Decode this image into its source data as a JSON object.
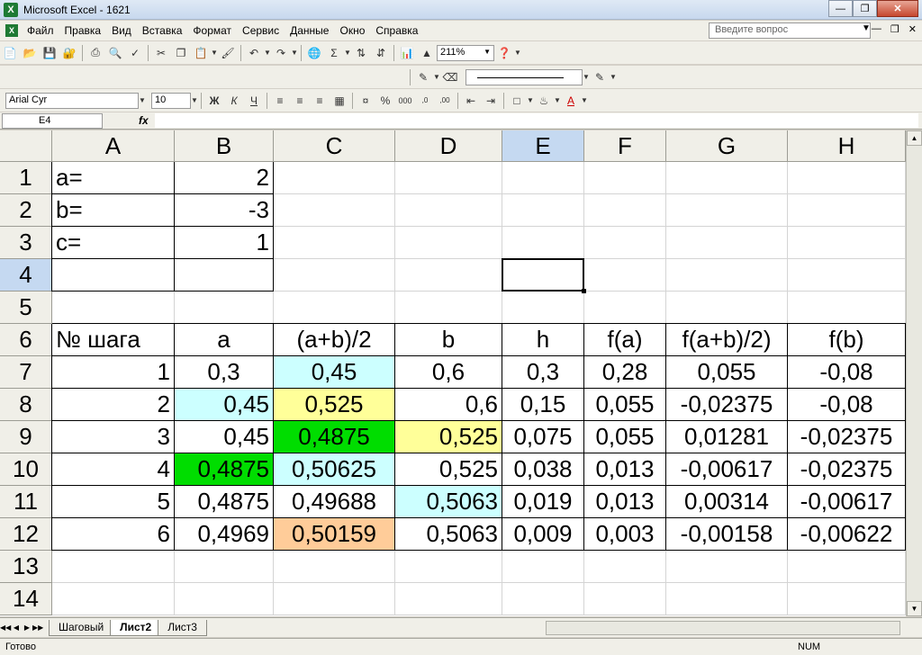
{
  "window": {
    "title": "Microsoft Excel - 1621",
    "app_icon": "X"
  },
  "menu": [
    "Файл",
    "Правка",
    "Вид",
    "Вставка",
    "Формат",
    "Сервис",
    "Данные",
    "Окно",
    "Справка"
  ],
  "help_box": {
    "placeholder": "Введите вопрос"
  },
  "toolbar": {
    "zoom": "211%",
    "font": "Arial Cyr",
    "size": "10"
  },
  "formula_bar": {
    "name_box": "E4",
    "fx": "fx",
    "content": ""
  },
  "columns": [
    "A",
    "B",
    "C",
    "D",
    "E",
    "F",
    "G",
    "H"
  ],
  "selected_column": "E",
  "selected_row": 4,
  "rows": [
    [
      "1",
      "a=",
      "2",
      "",
      "",
      "",
      "",
      "",
      ""
    ],
    [
      "2",
      "b=",
      "-3",
      "",
      "",
      "",
      "",
      "",
      ""
    ],
    [
      "3",
      "c=",
      "1",
      "",
      "",
      "",
      "",
      "",
      ""
    ],
    [
      "4",
      "",
      "",
      "",
      "",
      "",
      "",
      "",
      ""
    ],
    [
      "5",
      "",
      "",
      "",
      "",
      "",
      "",
      "",
      ""
    ],
    [
      "6",
      "№ шага",
      "a",
      "(a+b)/2",
      "b",
      "h",
      "f(a)",
      "f(a+b)/2)",
      "f(b)"
    ],
    [
      "7",
      "1",
      "0,3",
      "0,45",
      "0,6",
      "0,3",
      "0,28",
      "0,055",
      "-0,08"
    ],
    [
      "8",
      "2",
      "0,45",
      "0,525",
      "0,6",
      "0,15",
      "0,055",
      "-0,02375",
      "-0,08"
    ],
    [
      "9",
      "3",
      "0,45",
      "0,4875",
      "0,525",
      "0,075",
      "0,055",
      "0,01281",
      "-0,02375"
    ],
    [
      "10",
      "4",
      "0,4875",
      "0,50625",
      "0,525",
      "0,038",
      "0,013",
      "-0,00617",
      "-0,02375"
    ],
    [
      "11",
      "5",
      "0,4875",
      "0,49688",
      "0,5063",
      "0,019",
      "0,013",
      "0,00314",
      "-0,00617"
    ],
    [
      "12",
      "6",
      "0,4969",
      "0,50159",
      "0,5063",
      "0,009",
      "0,003",
      "-0,00158",
      "-0,00622"
    ],
    [
      "13",
      "",
      "",
      "",
      "",
      "",
      "",
      "",
      ""
    ],
    [
      "14",
      "",
      "",
      "",
      "",
      "",
      "",
      "",
      ""
    ]
  ],
  "fills": {
    "light_cyan": "#ccffff",
    "light_yellow": "#ffff99",
    "green": "#00dd00",
    "orange": "#ffcc99"
  },
  "sheets": [
    "Шаговый",
    "Лист2",
    "Лист3"
  ],
  "active_sheet": "Лист2",
  "status": {
    "left": "Готово",
    "right": "NUM"
  }
}
